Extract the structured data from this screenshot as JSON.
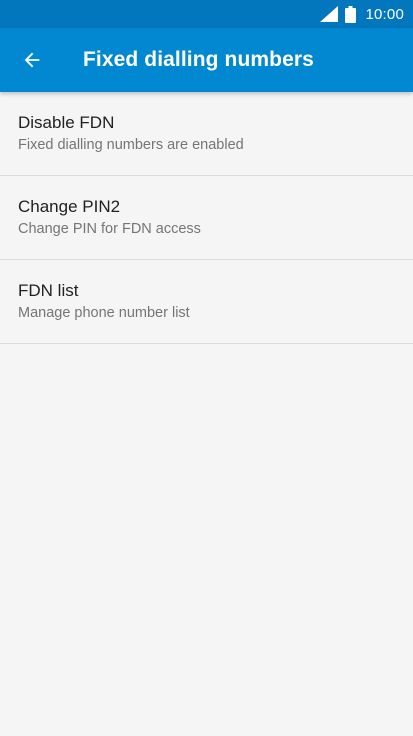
{
  "status_bar": {
    "time": "10:00",
    "signal_icon": "signal-icon",
    "battery_icon": "battery-icon"
  },
  "app_bar": {
    "title": "Fixed dialling numbers",
    "back_icon": "arrow-back-icon"
  },
  "items": [
    {
      "title": "Disable FDN",
      "summary": "Fixed dialling numbers are enabled"
    },
    {
      "title": "Change PIN2",
      "summary": "Change PIN for FDN access"
    },
    {
      "title": "FDN list",
      "summary": "Manage phone number list"
    }
  ],
  "colors": {
    "status_bar": "#0277bd",
    "app_bar": "#0288d1",
    "background": "#f5f5f5"
  }
}
